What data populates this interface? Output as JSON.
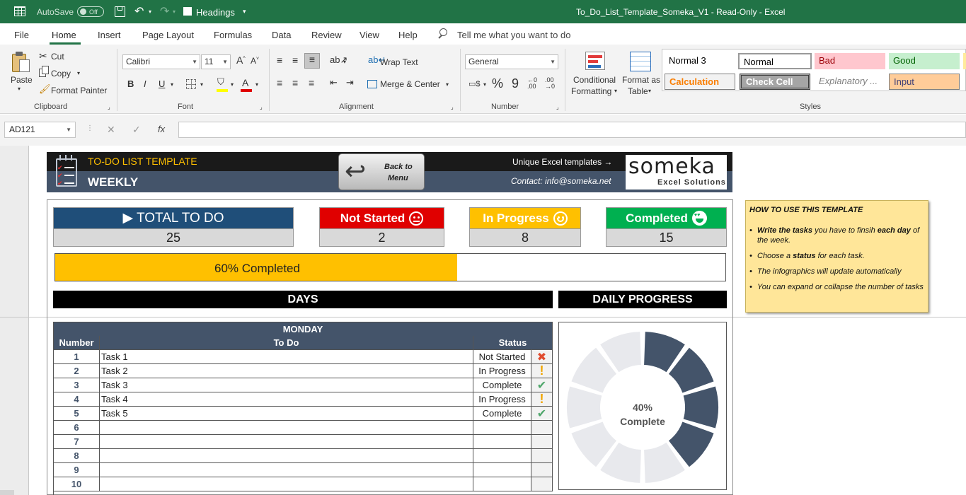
{
  "titlebar": {
    "autosave_label": "AutoSave",
    "autosave_state": "Off",
    "checkbox_label": "Headings",
    "document_title": "To_Do_List_Template_Someka_V1  -  Read-Only  -  Excel"
  },
  "menu": {
    "items": [
      "File",
      "Home",
      "Insert",
      "Page Layout",
      "Formulas",
      "Data",
      "Review",
      "View",
      "Help"
    ],
    "tell_me": "Tell me what you want to do"
  },
  "ribbon": {
    "clipboard": {
      "paste": "Paste",
      "cut": "Cut",
      "copy": "Copy",
      "format_painter": "Format Painter",
      "label": "Clipboard"
    },
    "font": {
      "name": "Calibri",
      "size": "11",
      "label": "Font",
      "bold": "B",
      "italic": "I",
      "underline": "U"
    },
    "alignment": {
      "wrap_text": "Wrap Text",
      "merge_center": "Merge & Center",
      "label": "Alignment"
    },
    "number": {
      "format": "General",
      "percent": "%",
      "comma": "9",
      "label": "Number"
    },
    "styles": {
      "conditional_formatting_1": "Conditional",
      "conditional_formatting_2": "Formatting",
      "format_as_table_1": "Format as",
      "format_as_table_2": "Table",
      "label": "Styles",
      "cells": [
        {
          "name": "Normal 3"
        },
        {
          "name": "Normal"
        },
        {
          "name": "Bad"
        },
        {
          "name": "Good"
        },
        {
          "name": "Calculation"
        },
        {
          "name": "Check Cell"
        },
        {
          "name": "Explanatory ..."
        },
        {
          "name": "Input"
        }
      ]
    }
  },
  "formula_bar": {
    "name_box": "AD121",
    "fx": "fx",
    "cancel": "✕",
    "enter": "✓"
  },
  "template": {
    "title": "TO-DO LIST TEMPLATE",
    "subtitle": "WEEKLY",
    "back_button_1": "Back to",
    "back_button_2": "Menu",
    "unique": "Unique Excel templates →",
    "contact": "Contact: info@someka.net",
    "brand_name": "someka",
    "brand_tagline": "Excel Solutions",
    "colors": {
      "navy": "#44546a",
      "header_dark": "#1a1a1a",
      "accent": "#ffc000",
      "red": "#e00000",
      "green": "#00b050"
    }
  },
  "kpis": {
    "total": {
      "label": "▶ TOTAL TO DO",
      "value": "25",
      "color": "#1f4e79"
    },
    "not_started": {
      "label": "Not Started",
      "value": "2",
      "color": "#e00000",
      "icon": "neutral-face-icon"
    },
    "in_progress": {
      "label": "In Progress",
      "value": "8",
      "color": "#ffc000",
      "icon": "smile-face-icon"
    },
    "completed": {
      "label": "Completed",
      "value": "15",
      "color": "#00b050",
      "icon": "heart-eyes-icon"
    }
  },
  "progress": {
    "label": "60% Completed",
    "fraction": 0.6
  },
  "sections": {
    "days": "DAYS",
    "daily_progress": "DAILY PROGRESS"
  },
  "table": {
    "day": "MONDAY",
    "headers": {
      "number": "Number",
      "todo": "To Do",
      "status": "Status"
    },
    "rows": [
      {
        "n": "1",
        "task": "Task 1",
        "status": "Not Started",
        "icon": "x"
      },
      {
        "n": "2",
        "task": "Task 2",
        "status": "In Progress",
        "icon": "!"
      },
      {
        "n": "3",
        "task": "Task 3",
        "status": "Complete",
        "icon": "check"
      },
      {
        "n": "4",
        "task": "Task 4",
        "status": "In Progress",
        "icon": "!"
      },
      {
        "n": "5",
        "task": "Task 5",
        "status": "Complete",
        "icon": "check"
      },
      {
        "n": "6",
        "task": "",
        "status": "",
        "icon": ""
      },
      {
        "n": "7",
        "task": "",
        "status": "",
        "icon": ""
      },
      {
        "n": "8",
        "task": "",
        "status": "",
        "icon": ""
      },
      {
        "n": "9",
        "task": "",
        "status": "",
        "icon": ""
      },
      {
        "n": "10",
        "task": "",
        "status": "",
        "icon": ""
      }
    ]
  },
  "donut": {
    "pct_label": "40%",
    "sub_label": "Complete",
    "segments_total": 10,
    "segments_filled": 4,
    "fill": "#44546a",
    "empty": "#e8e9ed"
  },
  "howto": {
    "title": "HOW TO USE THIS TEMPLATE",
    "b1_a": "Write the tasks",
    "b1_b": " you have to finsih ",
    "b1_c": "each day",
    "b1_d": " of the week.",
    "b2_a": "Choose a ",
    "b2_b": "status",
    "b2_c": " for each task.",
    "b3": "The infographics will update automatically",
    "b4": "You can expand or collapse the number of tasks"
  }
}
